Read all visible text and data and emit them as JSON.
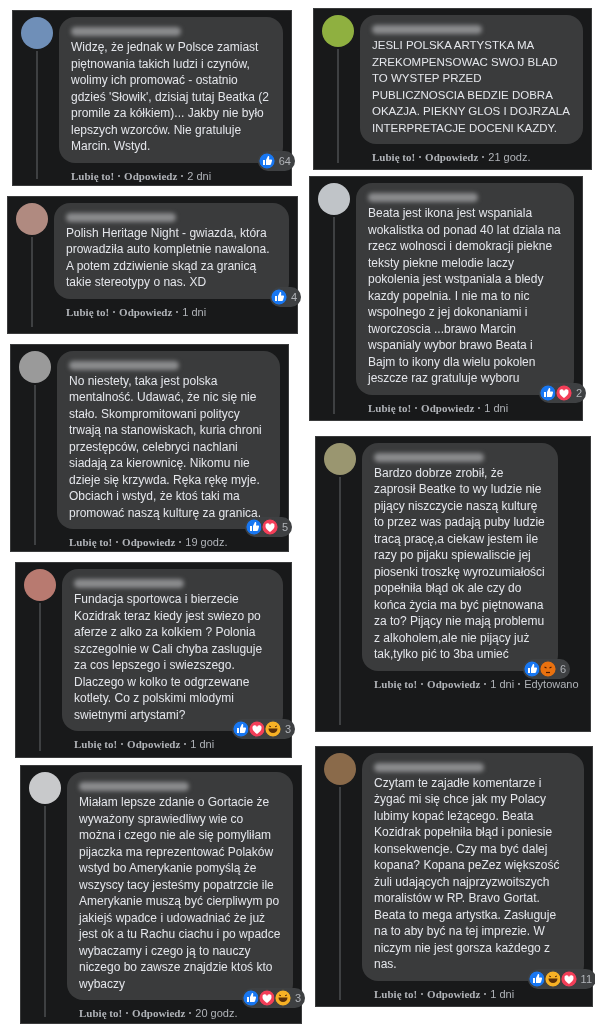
{
  "left_column": [
    {
      "color": "#6f8fb8",
      "text": "Widzę, że jednak w Polsce zamiast piętnowania takich ludzi i czynów, wolimy ich promować - ostatnio gdzieś 'Słowik', dzisiaj tutaj Beatka (2 promile za kółkiem)... Jakby nie było lepszych wzorców. Nie gratuluje Marcin. Wstyd.",
      "reactions": [
        {
          "kind": "like"
        }
      ],
      "reaction_count": "64",
      "like": "Lubię to!",
      "reply": "Odpowiedz",
      "time": "2 dni"
    },
    {
      "color": "#b08a80",
      "text": "Polish Heritage Night - gwiazda, która prowadziła auto kompletnie nawalona.\nA potem zdziwienie skąd za granicą takie stereotypy o nas. XD",
      "reactions": [
        {
          "kind": "like"
        }
      ],
      "reaction_count": "4",
      "like": "Lubię to!",
      "reply": "Odpowiedz",
      "time": "1 dni"
    },
    {
      "color": "#9a9a9a",
      "text": "No niestety, taka jest polska mentalność. Udawać, że nic się nie stało. Skompromitowani politycy trwają na stanowiskach, kuria chroni przestępców, celebryci nachlani siadają za kierownicę. Nikomu nie dzieje się krzywda. Ręka rękę myje. Obciach i wstyd, że ktoś taki ma promować naszą kulturę za granicą.",
      "reactions": [
        {
          "kind": "like"
        },
        {
          "kind": "love"
        }
      ],
      "reaction_count": "5",
      "like": "Lubię to!",
      "reply": "Odpowiedz",
      "time": "19 godz."
    },
    {
      "color": "#b87a70",
      "text": "Fundacja sportowca i bierzecie Kozidrak teraz kiedy jest swiezo po aferze z alko za kolkiem ? Polonia szczegolnie w Cali chyba zasluguje za cos lepszego i swiezszego. Dlaczego w kolko te odgrzewane kotlety. Co z polskimi mlodymi swietnymi artystami?",
      "reactions": [
        {
          "kind": "like"
        },
        {
          "kind": "love"
        },
        {
          "kind": "haha"
        }
      ],
      "reaction_count": "3",
      "like": "Lubię to!",
      "reply": "Odpowiedz",
      "time": "1 dni"
    },
    {
      "color": "#c8c9cb",
      "text": "Miałam lepsze zdanie o Gortacie że wyważony sprawiedliwy wie co można i czego nie ale się pomyliłam pijaczka ma reprezentować Polaków wstyd bo Amerykanie pomyślą że wszyscy tacy jesteśmy popatrzcie ile Amerykanie muszą być cierpliwym po jakiejś wpadce i udowadniać że już jest ok a tu Rachu ciachu i po wpadce wybaczamy i czego ją to nauczy niczego bo zawsze znajdzie ktoś kto wybaczy",
      "reactions": [
        {
          "kind": "like"
        },
        {
          "kind": "love"
        },
        {
          "kind": "haha"
        }
      ],
      "reaction_count": "3",
      "like": "Lubię to!",
      "reply": "Odpowiedz",
      "time": "20 godz."
    }
  ],
  "right_column": [
    {
      "color": "#8fb040",
      "text": "JESLI POLSKA ARTYSTKA MA ZREKOMPENSOWAC SWOJ BLAD TO WYSTEP PRZED PUBLICZNOSCIA BEDZIE DOBRA OKAZJA. PIEKNY GLOS I DOJRZALA INTERPRETACJE DOCENI KAZDY.",
      "like": "Lubię to!",
      "reply": "Odpowiedz",
      "time": "21 godz."
    },
    {
      "color": "#c0c4c8",
      "text": "Beata jest ikona jest wspaniala wokalistka od ponad 40 lat dziala na rzecz wolnosci i demokracji piekne teksty piekne melodie laczy pokolenia jest wstpaniala a bledy kazdy popelnia. I nie ma to nic wspolnego z jej dokonaniami i tworczoscia ...brawo Marcin wspanialy wybor brawo Beata i Bajm to ikony dla wielu pokolen jeszcze raz gratuluje wyboru",
      "reactions": [
        {
          "kind": "like"
        },
        {
          "kind": "love"
        }
      ],
      "reaction_count": "2",
      "like": "Lubię to!",
      "reply": "Odpowiedz",
      "time": "1 dni"
    },
    {
      "color": "#9a9670",
      "text": "Bardzo dobrze zrobił, że zaprosił Beatke to wy ludzie nie pijący niszczycie naszą kulturę to przez was padają puby ludzie tracą pracę,a ciekaw jestem ile razy po pijaku spiewaliscie jej piosenki troszkę wyrozumiałości popełniła błąd ok ale czy do końca życia ma być piętnowana za to? Pijący nie mają problemu z alkoholem,ale nie pijący już tak,tylko pić to 3ba umieć",
      "reactions": [
        {
          "kind": "like"
        },
        {
          "kind": "angry"
        }
      ],
      "reaction_count": "6",
      "like": "Lubię to!",
      "reply": "Odpowiedz",
      "time": "1 dni",
      "edited": "Edytowano"
    },
    {
      "color": "#8a6a4a",
      "text": "Czytam te zajadłe komentarze i żygać mi się chce jak my Polacy lubimy kopać leżącego. Beata Kozidrak popełniła błąd i poniesie konsekwencje. Czy ma być dalej kopana? Kopana peZez większość żuli udających najprzyzwoitszych moralistów w RP. Bravo Gortat. Beata to mega artystka. Zasługuje na to aby być na tej imprezie. W niczym nie jest gorsza każdego z nas.",
      "reactions": [
        {
          "kind": "like"
        },
        {
          "kind": "haha"
        },
        {
          "kind": "love"
        }
      ],
      "reaction_count": "11",
      "like": "Lubię to!",
      "reply": "Odpowiedz",
      "time": "1 dni"
    }
  ]
}
